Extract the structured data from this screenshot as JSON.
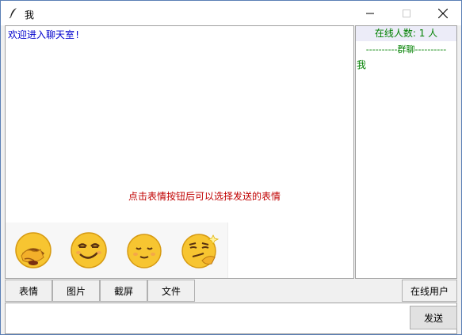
{
  "window": {
    "title": "我"
  },
  "chat": {
    "welcome": "欢迎进入聊天室!",
    "hint": "点击表情按钮后可以选择发送的表情"
  },
  "emojis": [
    {
      "name": "facepalm-emoji-icon"
    },
    {
      "name": "smirk-emoji-icon"
    },
    {
      "name": "content-smile-emoji-icon"
    },
    {
      "name": "thinking-smirk-emoji-icon"
    }
  ],
  "users": {
    "online_count": "在线人数: 1 人",
    "group_separator": "----------群聊----------",
    "list": [
      "我"
    ]
  },
  "toolbar": {
    "emoji_label": "表情",
    "image_label": "图片",
    "screenshot_label": "截屏",
    "file_label": "文件",
    "online_users_label": "在线用户"
  },
  "input": {
    "value": "",
    "send_label": "发送"
  },
  "colors": {
    "welcome": "#0000cc",
    "hint": "#c00000",
    "users_text": "#008000"
  }
}
